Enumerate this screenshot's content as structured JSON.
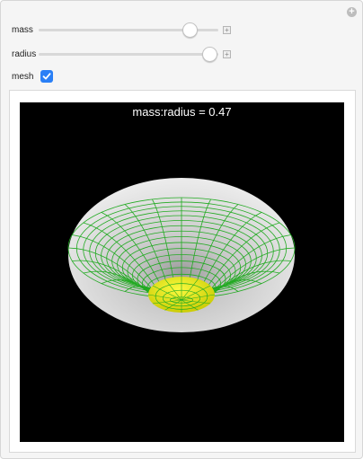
{
  "controls": {
    "mass": {
      "label": "mass",
      "fraction": 0.84
    },
    "radius": {
      "label": "radius",
      "fraction": 0.95
    },
    "mesh": {
      "label": "mesh",
      "checked": true
    }
  },
  "plot": {
    "title": "mass:radius = 0.47",
    "colors": {
      "background": "#000000",
      "surface": "#e6e6e6",
      "mesh": "#22aa22",
      "core": "#f0f000"
    }
  },
  "icons": {
    "corner": "plus-circle-icon",
    "mass_options": "plus-box-icon",
    "radius_options": "plus-box-icon",
    "mesh_check": "checkmark-icon"
  }
}
